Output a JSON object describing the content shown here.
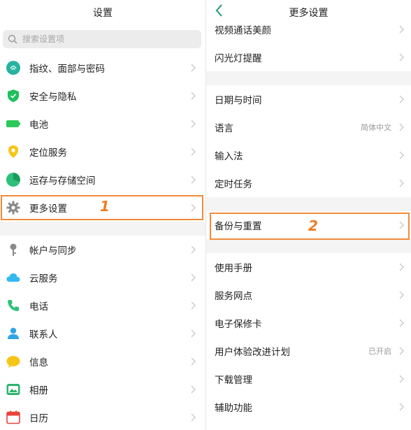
{
  "left": {
    "title": "设置",
    "search_placeholder": "搜索设置项",
    "items_group1": [
      {
        "label": "指纹、面部与密码",
        "icon": "fingerprint-icon",
        "color": "#26b3a0"
      },
      {
        "label": "安全与隐私",
        "icon": "shield-icon",
        "color": "#1fbf5c"
      },
      {
        "label": "电池",
        "icon": "battery-icon",
        "color": "#2dc85a"
      },
      {
        "label": "定位服务",
        "icon": "location-pin-icon",
        "color": "#f5c518"
      },
      {
        "label": "运存与存储空间",
        "icon": "storage-icon",
        "color": "#2cc07a"
      },
      {
        "label": "更多设置",
        "icon": "gear-icon",
        "color": "#8a8a8a"
      }
    ],
    "items_group2": [
      {
        "label": "帐户与同步",
        "icon": "key-icon",
        "color": "#8a8a8a"
      },
      {
        "label": "云服务",
        "icon": "cloud-icon",
        "color": "#33b8f0"
      },
      {
        "label": "电话",
        "icon": "phone-icon",
        "color": "#2dc27a"
      },
      {
        "label": "联系人",
        "icon": "contact-icon",
        "color": "#2ea6e6"
      },
      {
        "label": "信息",
        "icon": "message-icon",
        "color": "#f5c518"
      },
      {
        "label": "相册",
        "icon": "photo-icon",
        "color": "#2cb56f"
      },
      {
        "label": "日历",
        "icon": "calendar-icon",
        "color": "#e8443a"
      }
    ],
    "annotation": "1"
  },
  "right": {
    "title": "更多设置",
    "group0": [
      {
        "label": "视频通话美颜",
        "value": ""
      },
      {
        "label": "闪光灯提醒",
        "value": ""
      }
    ],
    "group1": [
      {
        "label": "日期与时间",
        "value": ""
      },
      {
        "label": "语言",
        "value": "简体中文"
      },
      {
        "label": "输入法",
        "value": ""
      },
      {
        "label": "定时任务",
        "value": ""
      }
    ],
    "group2": [
      {
        "label": "备份与重置",
        "value": ""
      }
    ],
    "group3": [
      {
        "label": "使用手册",
        "value": ""
      },
      {
        "label": "服务网点",
        "value": ""
      },
      {
        "label": "电子保修卡",
        "value": ""
      },
      {
        "label": "用户体验改进计划",
        "value": "已开启"
      },
      {
        "label": "下载管理",
        "value": ""
      },
      {
        "label": "辅助功能",
        "value": ""
      }
    ],
    "annotation": "2"
  },
  "colors": {
    "accent": "#1f9a6e",
    "highlight": "#f28a3a",
    "annotation": "#ef7d22"
  }
}
